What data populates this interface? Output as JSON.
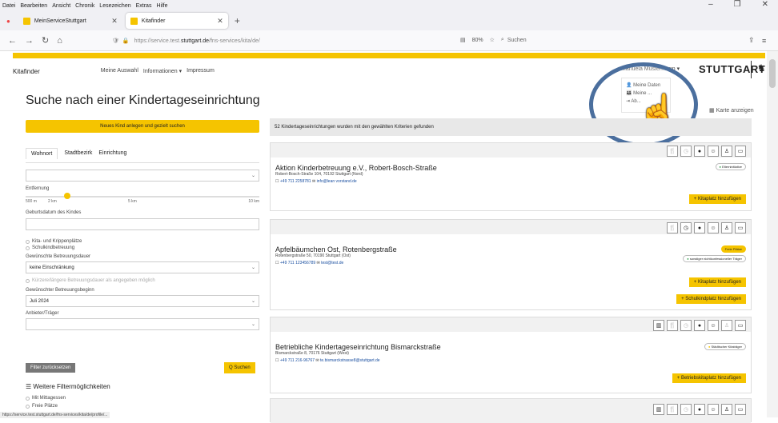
{
  "browser": {
    "menu": [
      "Datei",
      "Bearbeiten",
      "Ansicht",
      "Chronik",
      "Lesezeichen",
      "Extras",
      "Hilfe"
    ],
    "tabs": [
      {
        "title": "MeinServiceStuttgart"
      },
      {
        "title": "Kitafinder"
      }
    ],
    "url": "https://service.test.",
    "url_bold": "stuttgart.de",
    "url_rest": "/fns-services/kita/de/",
    "zoom": "80%",
    "search_placeholder": "Suchen"
  },
  "site": {
    "brand": "Kitafinder",
    "nav": [
      "Meine Auswahl",
      "Informationen ▾",
      "Impressum"
    ],
    "user": "Manuela Mustermann ▾",
    "logo": "STUTTGART",
    "user_menu": [
      "Meine Daten",
      "Meine ...",
      "Ab..."
    ],
    "karte": "Karte anzeigen",
    "page_title": "Suche nach einer Kindertageseinrichtung"
  },
  "filters": {
    "new_child": "Neues Kind anlegen und gezielt suchen",
    "tabs": [
      "Wohnort",
      "Stadtbezirk",
      "Einrichtung"
    ],
    "entfernung": "Entfernung",
    "ticks": [
      "500 m",
      "2 km",
      "5 km",
      "10 km"
    ],
    "geburtsdatum": "Geburtsdatum des Kindes",
    "kita": "Kita- und Krippenplätze",
    "schul": "Schulkindbetreuung",
    "dauer_label": "Gewünschte Betreuungsdauer",
    "dauer_value": "keine Einschränkung",
    "kuerzer": "Kürzere/längere Betreuungsdauer als angegeben möglich",
    "beginn_label": "Gewünschter Betreuungsbeginn",
    "beginn_value": "Juli 2024",
    "anbieter_label": "Anbieter/Träger",
    "reset": "Filter zurücksetzen",
    "search": "Q Suchen",
    "weitere": "Weitere Filtermöglichkeiten",
    "mittag": "Mit Mittagessen",
    "frei": "Freie Plätze"
  },
  "results": {
    "count_text": "52 Kindertageseinrichtungen wurden mit den gewählten Kriterien gefunden",
    "cards": [
      {
        "name": "Aktion Kinderbetreuung e.V., Robert-Bosch-Straße",
        "address": "Robert-Bosch-Straße 104, 70192 Stuttgart (Nord)",
        "phone": "+49 711 2258781",
        "email": "info@lean vorstand.de",
        "badge": "Elterninitiative",
        "btn": "+ Kitaplatz hinzufügen"
      },
      {
        "name": "Apfelbäumchen Ost, Rotenbergstraße",
        "address": "Rotenbergstraße 50, 70190 Stuttgart (Ost)",
        "phone": "+49 711 123456789",
        "email": "test@test.de",
        "badge_free": "Freie Plätze",
        "badge": "sonstiger nichtkonfessioneller Träger",
        "btn": "+ Kitaplatz hinzufügen",
        "btn2": "+ Schulkindplatz hinzufügen"
      },
      {
        "name": "Betriebliche Kindertageseinrichtung Bismarckstraße",
        "address": "Bismarckstraße 8, 70176 Stuttgart (West)",
        "phone": "+49 711 216-96767",
        "email": "te.bismarckstrasse8@stuttgart.de",
        "badge": "Städtischer Kitaträger",
        "btn": "+ Betriebskitaplatz hinzufügen"
      }
    ]
  },
  "statusbar": "https://service.test.stuttgart.de/fns-services/kita/de/profile/..."
}
